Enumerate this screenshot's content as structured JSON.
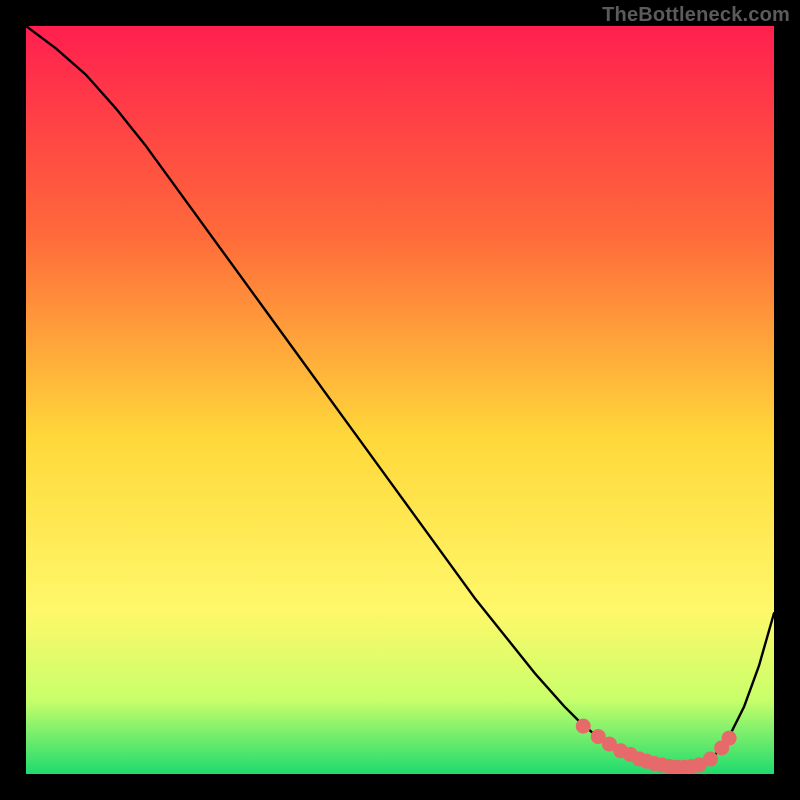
{
  "attribution": "TheBottleneck.com",
  "colors": {
    "gradient_top": "#ff1f4f",
    "gradient_mid_upper": "#ff6a3a",
    "gradient_mid": "#ffd83a",
    "gradient_mid_lower": "#fff86a",
    "gradient_lower": "#c9ff6a",
    "gradient_bottom": "#1edb6e",
    "curve": "#000000",
    "dots": "#e66a6a"
  },
  "chart_data": {
    "type": "line",
    "title": "",
    "xlabel": "",
    "ylabel": "",
    "xlim": [
      0,
      100
    ],
    "ylim": [
      0,
      100
    ],
    "grid": false,
    "legend": false,
    "x": [
      0,
      4,
      8,
      12,
      16,
      20,
      24,
      28,
      32,
      36,
      40,
      44,
      48,
      52,
      56,
      60,
      64,
      68,
      72,
      74,
      76,
      78,
      80,
      82,
      84,
      86,
      88,
      90,
      92,
      94,
      96,
      98,
      100
    ],
    "values": [
      100,
      97,
      93.5,
      89,
      84,
      78.5,
      73,
      67.5,
      62,
      56.5,
      51,
      45.5,
      40,
      34.5,
      29,
      23.5,
      18.5,
      13.5,
      9,
      7,
      5.3,
      3.9,
      2.8,
      2.0,
      1.4,
      1.0,
      0.9,
      1.2,
      2.4,
      5.0,
      9.0,
      14.5,
      21.5
    ],
    "dots": [
      {
        "x": 74.5,
        "y": 6.4
      },
      {
        "x": 76.5,
        "y": 5.0
      },
      {
        "x": 78.0,
        "y": 4.0
      },
      {
        "x": 79.5,
        "y": 3.1
      },
      {
        "x": 80.8,
        "y": 2.6
      },
      {
        "x": 82.0,
        "y": 2.0
      },
      {
        "x": 83.0,
        "y": 1.7
      },
      {
        "x": 84.0,
        "y": 1.4
      },
      {
        "x": 85.0,
        "y": 1.2
      },
      {
        "x": 86.0,
        "y": 1.0
      },
      {
        "x": 87.0,
        "y": 0.9
      },
      {
        "x": 88.0,
        "y": 0.9
      },
      {
        "x": 89.0,
        "y": 1.0
      },
      {
        "x": 90.0,
        "y": 1.2
      },
      {
        "x": 91.5,
        "y": 2.0
      },
      {
        "x": 93.0,
        "y": 3.5
      },
      {
        "x": 94.0,
        "y": 4.8
      }
    ]
  }
}
